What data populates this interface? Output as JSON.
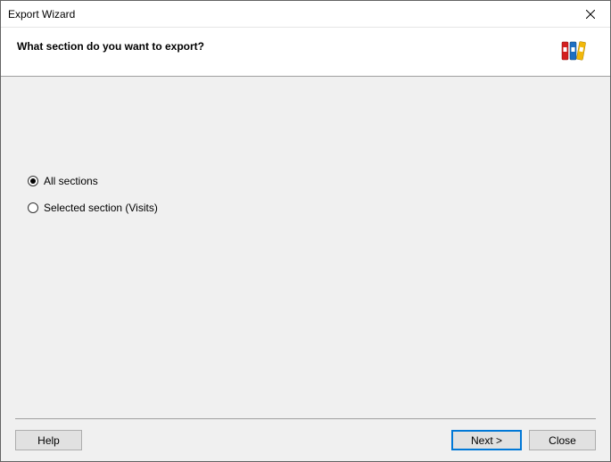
{
  "window": {
    "title": "Export Wizard"
  },
  "header": {
    "question": "What section do you want to export?"
  },
  "options": {
    "all_sections": {
      "label": "All sections",
      "selected": true
    },
    "selected_section": {
      "label": "Selected section (Visits)",
      "selected": false
    }
  },
  "buttons": {
    "help": "Help",
    "next": "Next >",
    "close": "Close"
  }
}
